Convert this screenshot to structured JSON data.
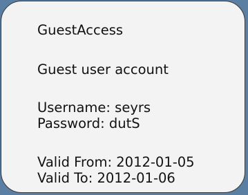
{
  "card": {
    "title": "GuestAccess",
    "subtitle": "Guest user account",
    "username_line": "Username: seyrs",
    "password_line": "Password: dutS",
    "valid_from_line": "Valid From: 2012-01-05",
    "valid_to_line": "Valid To: 2012-01-06"
  },
  "colors": {
    "background": "#5a7fa3",
    "card_fill": "#f3f3f3",
    "card_border": "#35373a",
    "text": "#111111"
  }
}
